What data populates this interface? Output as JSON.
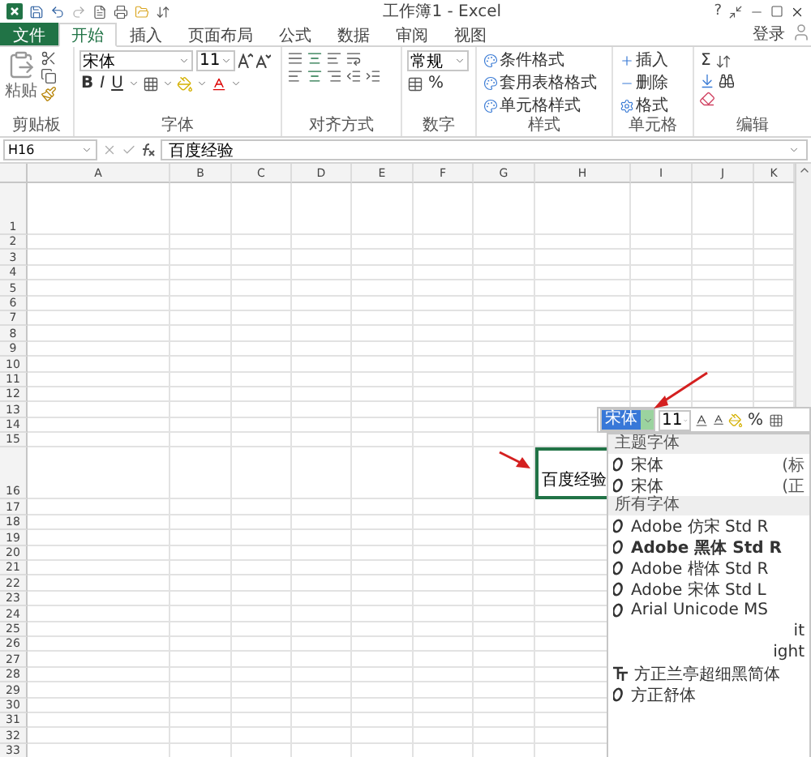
{
  "title_bar": {
    "title": "工作簿1 - Excel",
    "help": "?"
  },
  "tabs": [
    {
      "label": "文件",
      "kind": "file",
      "selected": false
    },
    {
      "label": "开始",
      "kind": "tab",
      "selected": true
    },
    {
      "label": "插入",
      "kind": "tab",
      "selected": false
    },
    {
      "label": "页面布局",
      "kind": "tab",
      "selected": false
    },
    {
      "label": "公式",
      "kind": "tab",
      "selected": false
    },
    {
      "label": "数据",
      "kind": "tab",
      "selected": false
    },
    {
      "label": "审阅",
      "kind": "tab",
      "selected": false
    },
    {
      "label": "视图",
      "kind": "tab",
      "selected": false
    }
  ],
  "account": "登录",
  "ribbon": {
    "clipboard": {
      "paste": "粘贴",
      "label": "剪贴板"
    },
    "font": {
      "name": "宋体",
      "size": "11",
      "bold": "B",
      "italic": "I",
      "underline": "U",
      "label": "字体"
    },
    "alignment": {
      "label": "对齐方式"
    },
    "number": {
      "format": "常规",
      "percent": "%",
      "label": "数字"
    },
    "styles": {
      "items": [
        "条件格式",
        "套用表格格式",
        "单元格样式"
      ],
      "label": "样式"
    },
    "cells": {
      "items": [
        "插入",
        "删除",
        "格式"
      ],
      "label": "单元格"
    },
    "editing": {
      "sum": "Σ",
      "label": "编辑"
    }
  },
  "formula_bar": {
    "name_box": "H16",
    "content": "百度经验"
  },
  "columns": [
    "A",
    "B",
    "C",
    "D",
    "E",
    "F",
    "G",
    "H",
    "I",
    "J",
    "K"
  ],
  "rows": [
    {
      "label": "1",
      "tall": true
    },
    {
      "label": "2",
      "tall": false
    },
    {
      "label": "3",
      "tall": false
    },
    {
      "label": "4",
      "tall": false
    },
    {
      "label": "5",
      "tall": false
    },
    {
      "label": "6",
      "tall": false
    },
    {
      "label": "7",
      "tall": false
    },
    {
      "label": "8",
      "tall": false
    },
    {
      "label": "9",
      "tall": false
    },
    {
      "label": "10",
      "tall": false
    },
    {
      "label": "11",
      "tall": false
    },
    {
      "label": "12",
      "tall": false
    },
    {
      "label": "13",
      "tall": false
    },
    {
      "label": "14",
      "tall": false
    },
    {
      "label": "15",
      "tall": false
    },
    {
      "label": "16",
      "tall": true,
      "cells": [
        null,
        null,
        null,
        null,
        null,
        null,
        null,
        {
          "text": "百度经验",
          "selected": true
        }
      ]
    },
    {
      "label": "17",
      "tall": false
    },
    {
      "label": "18",
      "tall": false
    },
    {
      "label": "19",
      "tall": false
    },
    {
      "label": "20",
      "tall": false
    },
    {
      "label": "21",
      "tall": false
    },
    {
      "label": "22",
      "tall": false
    },
    {
      "label": "23",
      "tall": false
    },
    {
      "label": "24",
      "tall": false
    },
    {
      "label": "25",
      "tall": false
    },
    {
      "label": "26",
      "tall": false
    },
    {
      "label": "27",
      "tall": false
    },
    {
      "label": "28",
      "tall": false
    },
    {
      "label": "29",
      "tall": false
    },
    {
      "label": "30",
      "tall": false
    },
    {
      "label": "31",
      "tall": false
    },
    {
      "label": "32",
      "tall": false
    },
    {
      "label": "33",
      "tall": false
    }
  ],
  "mini_toolbar": {
    "font": "宋体",
    "size": "11",
    "percent": "%"
  },
  "font_list": {
    "sections": [
      {
        "title": "主题字体",
        "items": [
          {
            "name": "宋体",
            "note": "(标",
            "kind": "opentype",
            "bold": false
          },
          {
            "name": "宋体",
            "note": "(正",
            "kind": "opentype",
            "bold": false
          }
        ]
      },
      {
        "title": "所有字体",
        "items": [
          {
            "name": "Adobe 仿宋 Std R",
            "kind": "opentype",
            "bold": false
          },
          {
            "name": "Adobe 黑体 Std R",
            "kind": "opentype",
            "bold": true
          },
          {
            "name": "Adobe 楷体 Std R",
            "kind": "opentype",
            "bold": false
          },
          {
            "name": "Adobe 宋体 Std L",
            "kind": "opentype",
            "bold": false
          },
          {
            "name": "Arial Unicode MS",
            "kind": "opentype",
            "bold": false
          },
          {
            "name": "it",
            "kind": "fragment",
            "bold": false
          },
          {
            "name": "ight",
            "kind": "fragment",
            "bold": false
          },
          {
            "name": "方正兰亭超细黑简体",
            "kind": "truetype",
            "bold": false
          },
          {
            "name": "方正舒体",
            "kind": "opentype",
            "bold": false
          }
        ]
      }
    ]
  }
}
